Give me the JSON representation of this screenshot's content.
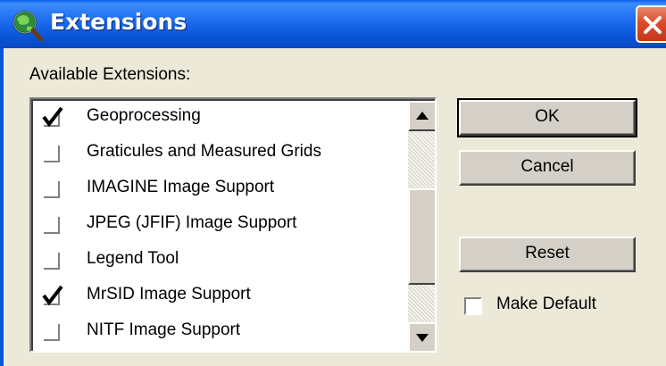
{
  "window": {
    "title": "Extensions",
    "app_icon": "globe-magnifier-icon",
    "close_icon": "close-icon"
  },
  "available_label": "Available Extensions:",
  "extensions": [
    {
      "label": "Geoprocessing",
      "checked": true
    },
    {
      "label": "Graticules and Measured Grids",
      "checked": false
    },
    {
      "label": "IMAGINE Image Support",
      "checked": false
    },
    {
      "label": "JPEG (JFIF) Image Support",
      "checked": false
    },
    {
      "label": "Legend Tool",
      "checked": false
    },
    {
      "label": "MrSID Image Support",
      "checked": true
    },
    {
      "label": "NITF Image Support",
      "checked": false
    }
  ],
  "buttons": {
    "ok": "OK",
    "cancel": "Cancel",
    "reset": "Reset"
  },
  "make_default": {
    "label": "Make Default",
    "checked": false
  },
  "colors": {
    "titlebar": "#0A55D9",
    "face": "#ECE9D8",
    "close": "#DB4B2A"
  }
}
